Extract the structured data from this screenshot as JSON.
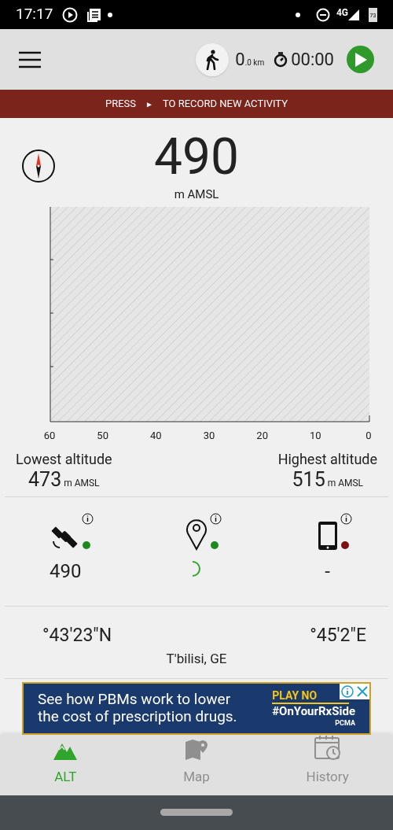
{
  "status_bar": {
    "time": "17:17",
    "network": "4G",
    "battery": "73"
  },
  "toolbar": {
    "distance": "0",
    "distance_decimal": ".0 km",
    "timer": "00:00"
  },
  "banner": {
    "before": "PRESS",
    "symbol": "►",
    "after": "TO RECORD NEW ACTIVITY"
  },
  "altitude": {
    "value": "490",
    "unit": "m AMSL"
  },
  "chart": {
    "x_axis_labels": [
      "60",
      "50",
      "40",
      "30",
      "20",
      "10",
      "0"
    ]
  },
  "extremes": [
    {
      "label": "Lowest altitude",
      "value": "473",
      "unit": "m AMSL"
    },
    {
      "label": "Highest altitude",
      "value": "515",
      "unit": "m AMSL"
    }
  ],
  "sources": [
    {
      "kind": "satellite",
      "color": "#1e8a1e",
      "reading": "490"
    },
    {
      "kind": "location",
      "color": "#1e8a1e",
      "loading": true
    },
    {
      "kind": "phone",
      "color": "#7a1010",
      "reading": "-"
    }
  ],
  "coordinates": {
    "latitude": "°43'23\"N",
    "longitude": "°45'2\"E",
    "place": "T'bilisi, GE"
  },
  "ad": {
    "headline": "See how PBMs work to lower the cost of prescription drugs.",
    "cta": "PLAY NO",
    "hashtag": "#OnYourRxSide",
    "brand": "PCMA"
  },
  "tabs": [
    {
      "kind": "alt",
      "label": "ALT",
      "selected": true
    },
    {
      "kind": "map",
      "label": "Map",
      "selected": false
    },
    {
      "kind": "history",
      "label": "History",
      "selected": false
    }
  ]
}
